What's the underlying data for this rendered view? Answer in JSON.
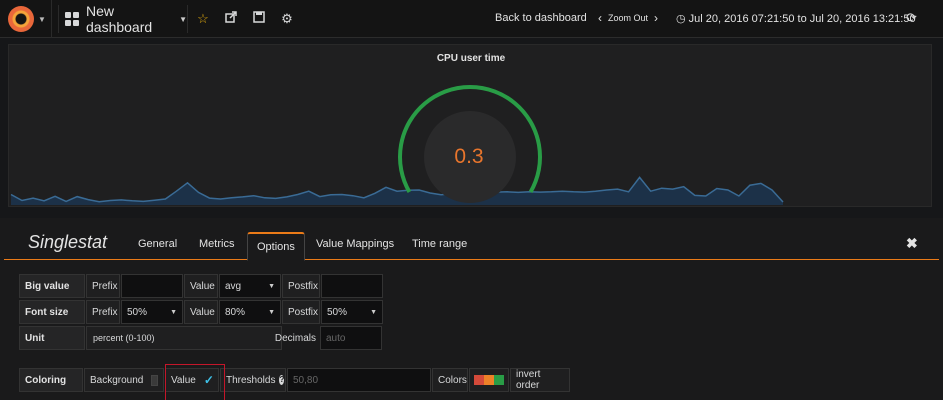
{
  "navbar": {
    "dashboard_title": "New dashboard",
    "back_label": "Back to dashboard",
    "zoom_label": "Zoom Out",
    "time_range": "Jul 20, 2016 07:21:50 to Jul 20, 2016 13:21:50",
    "icons": [
      "grafana-logo-icon",
      "dashboard-grid-icon",
      "star-icon",
      "share-icon",
      "save-icon",
      "gear-icon",
      "chevron-left-icon",
      "chevron-right-icon",
      "clock-icon",
      "refresh-icon"
    ]
  },
  "panel": {
    "title": "CPU user time",
    "value": "0.3",
    "gauge": {
      "min": 0,
      "max": 100,
      "value": 0.3,
      "thresholds": [
        50,
        80
      ]
    },
    "sparkline": [
      3.5,
      1.5,
      2.3,
      1.4,
      2.9,
      1.2,
      2.8,
      1.8,
      1.1,
      1.5,
      1.7,
      1.4,
      1.2,
      1.6,
      2.0,
      4.6,
      7.4,
      4.2,
      2.3,
      2.0,
      2.4,
      2.7,
      3.1,
      2.4,
      2.2,
      2.7,
      3.5,
      4.6,
      2.8,
      3.4,
      3.5,
      3.1,
      2.4,
      3.9,
      5.9,
      4.6,
      4.9,
      5.0,
      4.0,
      3.4,
      3.8,
      4.2,
      8.6,
      4.2,
      4.3,
      4.4,
      4.2,
      4.4,
      4.3,
      4.4,
      4.6,
      4.4,
      4.3,
      4.6,
      5.0,
      5.3,
      4.4,
      9.2,
      4.6,
      5.6,
      5.3,
      6.1,
      3.2,
      3.0,
      5.5,
      5.0,
      3.0,
      6.6,
      7.2,
      5.0,
      1.0
    ],
    "colors": {
      "ok": "#299c46",
      "warn": "#e8752c",
      "line": "#3a6b95",
      "fill": "#1c3148"
    }
  },
  "editor": {
    "title": "Singlestat",
    "tabs": [
      "General",
      "Metrics",
      "Options",
      "Value Mappings",
      "Time range"
    ],
    "active_tab": "Options",
    "big_value": {
      "label": "Big value",
      "prefix_label": "Prefix",
      "value_label": "Value",
      "value": "avg",
      "postfix_label": "Postfix"
    },
    "font_size": {
      "label": "Font size",
      "prefix_label": "Prefix",
      "prefix_value": "50%",
      "value_label": "Value",
      "value_value": "80%",
      "postfix_label": "Postfix",
      "postfix_value": "50%"
    },
    "unit": {
      "label": "Unit",
      "value": "percent (0-100)",
      "decimals_label": "Decimals",
      "decimals_placeholder": "auto"
    },
    "coloring": {
      "label": "Coloring",
      "background_label": "Background",
      "background_checked": false,
      "value_label": "Value",
      "value_checked": true,
      "thresholds_label": "Thresholds",
      "thresholds_placeholder": "50,80",
      "colors_label": "Colors",
      "colors": [
        "#d44a3a",
        "#ed8128",
        "#299c46"
      ],
      "invert_label": "invert order"
    }
  }
}
